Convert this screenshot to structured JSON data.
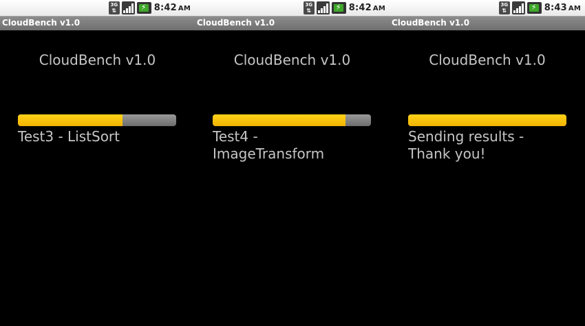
{
  "screens": [
    {
      "status_bar": {
        "time": "8:42",
        "ampm": "AM",
        "network": "3G"
      },
      "title_bar": "CloudBench v1.0",
      "heading": "CloudBench v1.0",
      "progress": {
        "percent": 66
      },
      "status_lines": [
        "Test3 - ListSort"
      ]
    },
    {
      "status_bar": {
        "time": "8:42",
        "ampm": "AM",
        "network": "3G"
      },
      "title_bar": "CloudBench v1.0",
      "heading": "CloudBench v1.0",
      "progress": {
        "percent": 84
      },
      "status_lines": [
        "Test4 -",
        "ImageTransform"
      ]
    },
    {
      "status_bar": {
        "time": "8:43",
        "ampm": "AM",
        "network": "3G"
      },
      "title_bar": "CloudBench v1.0",
      "heading": "CloudBench v1.0",
      "progress": {
        "percent": 100
      },
      "status_lines": [
        "Sending results -",
        "Thank you!"
      ]
    }
  ],
  "colors": {
    "progress_fill": "#ffc600",
    "progress_track": "#808080",
    "text": "#c6c6c6",
    "title_bar": "#7b7b7b",
    "battery": "#3fa82a"
  },
  "icons": [
    "network-3g-icon",
    "signal-icon",
    "battery-charging-icon"
  ]
}
